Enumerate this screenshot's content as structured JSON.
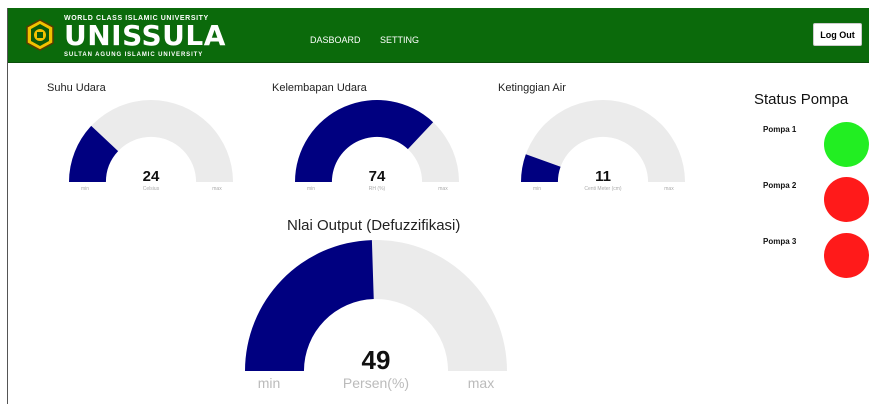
{
  "header": {
    "brand_top": "WORLD CLASS ISLAMIC UNIVERSITY",
    "brand_main": "UNISSULA",
    "brand_bottom": "SULTAN AGUNG ISLAMIC UNIVERSITY",
    "nav": [
      "DASBOARD",
      "SETTING"
    ],
    "logout_label": "Log Out",
    "bg_color": "#0b6a0b"
  },
  "gauges": [
    {
      "title": "Suhu Udara",
      "value": "24",
      "fraction": 0.24,
      "unit": "Celsius",
      "min_label": "min",
      "max_label": "max"
    },
    {
      "title": "Kelembapan Udara",
      "value": "74",
      "fraction": 0.74,
      "unit": "RH (%)",
      "min_label": "min",
      "max_label": "max"
    },
    {
      "title": "Ketinggian Air",
      "value": "11",
      "fraction": 0.11,
      "unit": "Centi Meter (cm)",
      "min_label": "min",
      "max_label": "max"
    }
  ],
  "output_gauge": {
    "title": "Nlai Output (Defuzzifikasi)",
    "value": "49",
    "fraction": 0.49,
    "unit": "Persen(%)",
    "min_label": "min",
    "max_label": "max"
  },
  "status": {
    "title": "Status Pompa",
    "pumps": [
      {
        "label": "Pompa 1",
        "state_color": "#22ee22"
      },
      {
        "label": "Pompa 2",
        "state_color": "#ff1a1a"
      },
      {
        "label": "Pompa 3",
        "state_color": "#ff1a1a"
      }
    ]
  },
  "colors": {
    "gauge_fill": "#000080",
    "gauge_track": "#ebebeb"
  }
}
